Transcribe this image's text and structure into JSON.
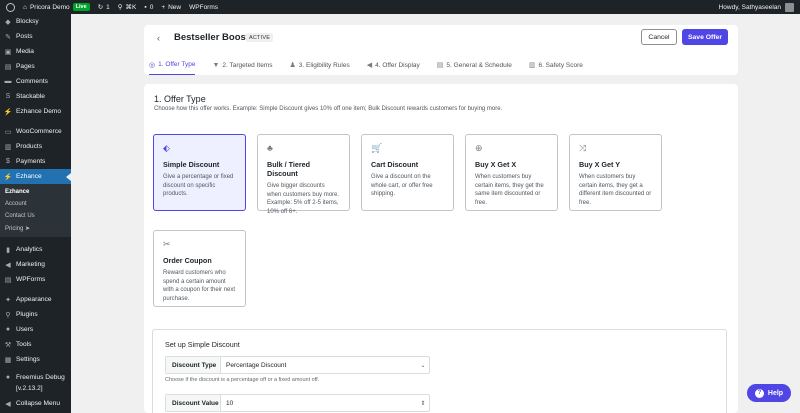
{
  "adminbar": {
    "site_name": "Pricora Demo",
    "live_label": "Live",
    "updates_count": "1",
    "shortcut": "⌘K",
    "comments_count": "0",
    "new_label": "New",
    "wpforms_label": "WPForms",
    "greeting": "Howdy, Sathyaseelan"
  },
  "sidebar": {
    "top": [
      {
        "name": "blocksy",
        "label": "Blocksy",
        "icon": "◆"
      },
      {
        "name": "posts",
        "label": "Posts",
        "icon": "✎"
      },
      {
        "name": "media",
        "label": "Media",
        "icon": "▣"
      },
      {
        "name": "pages",
        "label": "Pages",
        "icon": "▤"
      },
      {
        "name": "comments",
        "label": "Comments",
        "icon": "▬"
      },
      {
        "name": "stackable",
        "label": "Stackable",
        "icon": "S"
      },
      {
        "name": "ezhance-demo",
        "label": "Ezhance Demo",
        "icon": "⚡"
      }
    ],
    "commerce": [
      {
        "name": "woocommerce",
        "label": "WooCommerce",
        "icon": "▭"
      },
      {
        "name": "products",
        "label": "Products",
        "icon": "▥"
      },
      {
        "name": "payments",
        "label": "Payments",
        "icon": "$"
      }
    ],
    "active": {
      "name": "ezhance",
      "label": "Ezhance",
      "icon": "⚡"
    },
    "submenu": [
      {
        "name": "ezhance",
        "label": "Ezhance"
      },
      {
        "name": "account",
        "label": "Account"
      },
      {
        "name": "contact-us",
        "label": "Contact Us"
      },
      {
        "name": "pricing",
        "label": "Pricing ➤"
      }
    ],
    "middle": [
      {
        "name": "analytics",
        "label": "Analytics",
        "icon": "▮"
      },
      {
        "name": "marketing",
        "label": "Marketing",
        "icon": "◀"
      },
      {
        "name": "wpforms",
        "label": "WPForms",
        "icon": "▤"
      }
    ],
    "bottom": [
      {
        "name": "appearance",
        "label": "Appearance",
        "icon": "✦"
      },
      {
        "name": "plugins",
        "label": "Plugins",
        "icon": "⚲"
      },
      {
        "name": "users",
        "label": "Users",
        "icon": "●"
      },
      {
        "name": "tools",
        "label": "Tools",
        "icon": "⚒"
      },
      {
        "name": "settings",
        "label": "Settings",
        "icon": "▦"
      }
    ],
    "freemius_line1": "Freemius Debug",
    "freemius_line2": "[v.2.13.2]",
    "collapse": "Collapse Menu"
  },
  "header": {
    "title": "Bestseller Boost",
    "status": "ACTIVE",
    "cancel": "Cancel",
    "save": "Save Offer"
  },
  "tabs": [
    {
      "name": "offer-type",
      "label": "1. Offer Type",
      "icon": "◎"
    },
    {
      "name": "targeted-items",
      "label": "2. Targeted Items",
      "icon": "▼"
    },
    {
      "name": "eligibility-rules",
      "label": "3. Eligibility Rules",
      "icon": "♟"
    },
    {
      "name": "offer-display",
      "label": "4. Offer Display",
      "icon": "◀"
    },
    {
      "name": "general-schedule",
      "label": "5. General & Schedule",
      "icon": "▤"
    },
    {
      "name": "safety-score",
      "label": "6. Safety Score",
      "icon": "▥"
    }
  ],
  "section": {
    "title": "1. Offer Type",
    "description": "Choose how this offer works. Example: Simple Discount gives 10% off one item; Bulk Discount rewards customers for buying more."
  },
  "offer_types": [
    {
      "name": "simple-discount",
      "icon": "⬖",
      "title": "Simple Discount",
      "desc": "Give a percentage or fixed discount on specific products."
    },
    {
      "name": "bulk-tiered-discount",
      "icon": "♣",
      "title": "Bulk / Tiered Discount",
      "desc": "Give bigger discounts when customers buy more. Example: 5% off 2-5 items, 10% off 6+."
    },
    {
      "name": "cart-discount",
      "icon": "🛒",
      "title": "Cart Discount",
      "desc": "Give a discount on the whole cart, or offer free shipping."
    },
    {
      "name": "buy-x-get-x",
      "icon": "⊕",
      "title": "Buy X Get X",
      "desc": "When customers buy certain items, they get the same item discounted or free."
    },
    {
      "name": "buy-x-get-y",
      "icon": "⤨",
      "title": "Buy X Get Y",
      "desc": "When customers buy certain items, they get a different item discounted or free."
    },
    {
      "name": "order-coupon",
      "icon": "✂",
      "title": "Order Coupon",
      "desc": "Reward customers who spend a certain amount with a coupon for their next purchase."
    }
  ],
  "setup": {
    "title": "Set up Simple Discount",
    "discount_type_label": "Discount Type",
    "discount_type_value": "Percentage Discount",
    "discount_type_help": "Choose if the discount is a percentage off or a fixed amount off.",
    "discount_value_label": "Discount Value",
    "discount_value": "10"
  },
  "help": {
    "label": "Help"
  }
}
